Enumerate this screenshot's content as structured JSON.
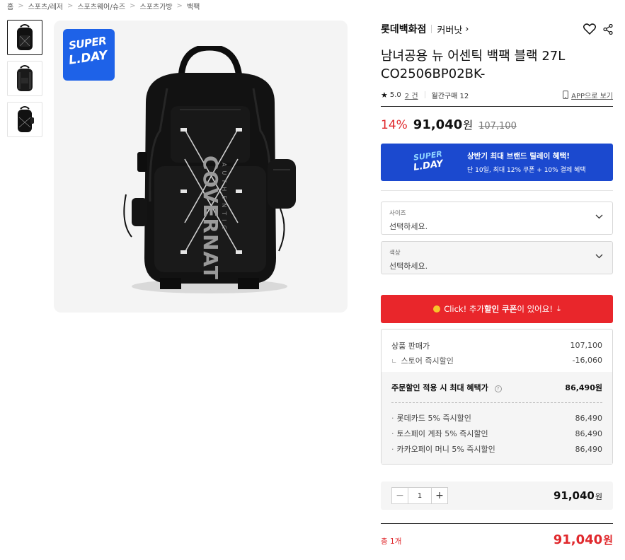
{
  "breadcrumb": [
    "홈",
    "스포츠/레저",
    "스포츠웨어/슈즈",
    "스포츠가방",
    "백팩"
  ],
  "badge": {
    "line1": "SUPER",
    "line2": "L.DAY"
  },
  "product": {
    "brand": "롯데백화점",
    "sub_brand": "커버낫",
    "title": "남녀공용 뉴 어센틱 백팩 블랙 27L CO2506BP02BK-",
    "rating": "5.0",
    "reviews": "2 건",
    "monthly_purchases": "월간구매 12",
    "app_link": "APP으로 보기"
  },
  "price": {
    "discount": "14%",
    "sale": "91,040",
    "unit": "원",
    "original": "107,100"
  },
  "promo": {
    "logo_line1": "SUPER",
    "logo_line2": "L.DAY",
    "title": "상반기 최대 브랜드 릴레이 혜택!",
    "subtitle": "단 10일, 최대 12% 쿠폰 + 10% 결제 혜택"
  },
  "options": [
    {
      "label": "사이즈",
      "value": "선택하세요."
    },
    {
      "label": "색상",
      "value": "선택하세요."
    }
  ],
  "coupon": {
    "pre": "Click! 추가 ",
    "bold": "할인 쿠폰",
    "post": "이 있어요!",
    "download": "⤓"
  },
  "breakdown": {
    "list_label": "상품 판매가",
    "list_value": "107,100",
    "store_label": "스토어 즉시할인",
    "store_value": "-16,060",
    "benefit_label": "주문할인 적용 시 최대 혜택가",
    "benefit_value": "86,490원",
    "cards": [
      {
        "label": "롯데카드 5% 즉시할인",
        "value": "86,490"
      },
      {
        "label": "토스페이 계좌 5% 즉시할인",
        "value": "86,490"
      },
      {
        "label": "카카오페이 머니 5% 즉시할인",
        "value": "86,490"
      }
    ]
  },
  "quantity": {
    "value": "1",
    "price": "91,040",
    "unit": "원"
  },
  "total": {
    "label": "총 1개",
    "price": "91,040",
    "unit": "원"
  },
  "colors": {
    "accent_red": "#e9262b",
    "promo_blue": "#1b49cf",
    "badge_blue": "#1e62e8"
  }
}
